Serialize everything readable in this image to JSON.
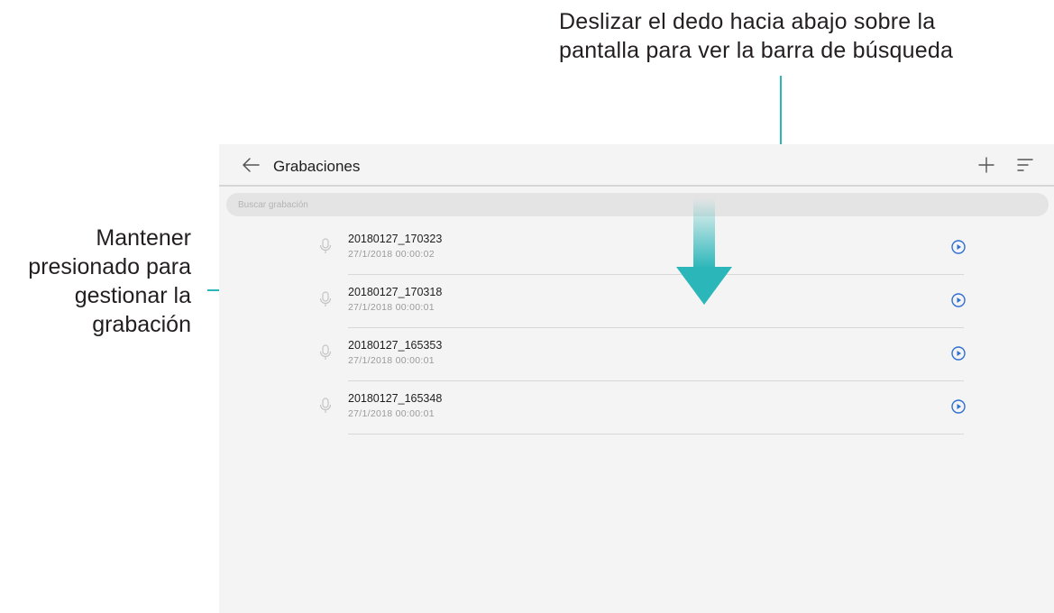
{
  "annotations": {
    "top_callout": "Deslizar el dedo hacia abajo sobre la pantalla para ver la barra de búsqueda",
    "left_callout": "Mantener presionado para gestionar la grabación"
  },
  "appbar": {
    "title": "Grabaciones",
    "back_icon": "arrow-left-icon",
    "add_icon": "plus-icon",
    "sort_icon": "sort-icon"
  },
  "search": {
    "placeholder": "Buscar grabación"
  },
  "recordings": [
    {
      "name": "20180127_170323",
      "date": "27/1/2018",
      "duration": "00:00:02",
      "meta": "27/1/2018    00:00:02"
    },
    {
      "name": "20180127_170318",
      "date": "27/1/2018",
      "duration": "00:00:01",
      "meta": "27/1/2018    00:00:01"
    },
    {
      "name": "20180127_165353",
      "date": "27/1/2018",
      "duration": "00:00:01",
      "meta": "27/1/2018    00:00:01"
    },
    {
      "name": "20180127_165348",
      "date": "27/1/2018",
      "duration": "00:00:01",
      "meta": "27/1/2018    00:00:01"
    }
  ],
  "colors": {
    "accent": "#2bb6b9",
    "play": "#2f6fcf",
    "screen_bg": "#f4f4f4"
  }
}
